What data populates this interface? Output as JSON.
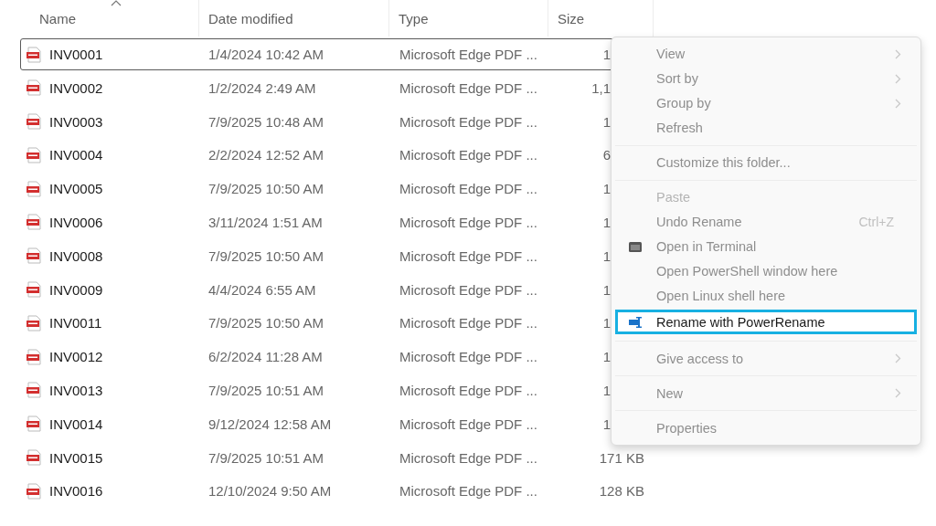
{
  "columns": [
    {
      "label": "Name",
      "sorted": true
    },
    {
      "label": "Date modified",
      "sorted": false
    },
    {
      "label": "Type",
      "sorted": false
    },
    {
      "label": "Size",
      "sorted": false
    }
  ],
  "rows": [
    {
      "name": "INV0001",
      "date": "1/4/2024 10:42 AM",
      "type": "Microsoft Edge PDF ...",
      "size": "1",
      "selected": true
    },
    {
      "name": "INV0002",
      "date": "1/2/2024 2:49 AM",
      "type": "Microsoft Edge PDF ...",
      "size": "1,1",
      "selected": false
    },
    {
      "name": "INV0003",
      "date": "7/9/2025 10:48 AM",
      "type": "Microsoft Edge PDF ...",
      "size": "1",
      "selected": false
    },
    {
      "name": "INV0004",
      "date": "2/2/2024 12:52 AM",
      "type": "Microsoft Edge PDF ...",
      "size": "6",
      "selected": false
    },
    {
      "name": "INV0005",
      "date": "7/9/2025 10:50 AM",
      "type": "Microsoft Edge PDF ...",
      "size": "1",
      "selected": false
    },
    {
      "name": "INV0006",
      "date": "3/11/2024 1:51 AM",
      "type": "Microsoft Edge PDF ...",
      "size": "1",
      "selected": false
    },
    {
      "name": "INV0008",
      "date": "7/9/2025 10:50 AM",
      "type": "Microsoft Edge PDF ...",
      "size": "1",
      "selected": false
    },
    {
      "name": "INV0009",
      "date": "4/4/2024 6:55 AM",
      "type": "Microsoft Edge PDF ...",
      "size": "1",
      "selected": false
    },
    {
      "name": "INV0011",
      "date": "7/9/2025 10:50 AM",
      "type": "Microsoft Edge PDF ...",
      "size": "1",
      "selected": false
    },
    {
      "name": "INV0012",
      "date": "6/2/2024 11:28 AM",
      "type": "Microsoft Edge PDF ...",
      "size": "1",
      "selected": false
    },
    {
      "name": "INV0013",
      "date": "7/9/2025 10:51 AM",
      "type": "Microsoft Edge PDF ...",
      "size": "1",
      "selected": false
    },
    {
      "name": "INV0014",
      "date": "9/12/2024 12:58 AM",
      "type": "Microsoft Edge PDF ...",
      "size": "1",
      "selected": false
    },
    {
      "name": "INV0015",
      "date": "7/9/2025 10:51 AM",
      "type": "Microsoft Edge PDF ...",
      "size": "171 KB",
      "selected": false
    },
    {
      "name": "INV0016",
      "date": "12/10/2024 9:50 AM",
      "type": "Microsoft Edge PDF ...",
      "size": "128 KB",
      "selected": false
    }
  ],
  "context_menu": [
    {
      "kind": "item",
      "label": "View",
      "submenu": true,
      "blurred": true,
      "selected": false
    },
    {
      "kind": "item",
      "label": "Sort by",
      "submenu": true,
      "blurred": true,
      "selected": false
    },
    {
      "kind": "item",
      "label": "Group by",
      "submenu": true,
      "blurred": true,
      "selected": false
    },
    {
      "kind": "item",
      "label": "Refresh",
      "submenu": false,
      "blurred": true,
      "selected": false
    },
    {
      "kind": "separator"
    },
    {
      "kind": "item",
      "label": "Customize this folder...",
      "submenu": false,
      "blurred": true,
      "selected": false
    },
    {
      "kind": "separator"
    },
    {
      "kind": "item",
      "label": "Paste",
      "submenu": false,
      "blurred": true,
      "disabled": true,
      "selected": false
    },
    {
      "kind": "item",
      "label": "Undo Rename",
      "shortcut": "Ctrl+Z",
      "submenu": false,
      "blurred": true,
      "selected": false
    },
    {
      "kind": "terminal",
      "label": "Open in Terminal",
      "submenu": false,
      "blurred": true,
      "selected": false
    },
    {
      "kind": "item",
      "label": "Open PowerShell window here",
      "submenu": false,
      "blurred": true,
      "selected": false
    },
    {
      "kind": "item",
      "label": "Open Linux shell here",
      "submenu": false,
      "blurred": true,
      "selected": false
    },
    {
      "kind": "rename",
      "label": "Rename with PowerRename",
      "submenu": false,
      "blurred": false,
      "selected": true
    },
    {
      "kind": "separator"
    },
    {
      "kind": "item",
      "label": "Give access to",
      "submenu": true,
      "blurred": true,
      "selected": false
    },
    {
      "kind": "separator"
    },
    {
      "kind": "item",
      "label": "New",
      "submenu": true,
      "blurred": true,
      "selected": false
    },
    {
      "kind": "separator"
    },
    {
      "kind": "item",
      "label": "Properties",
      "submenu": false,
      "blurred": true,
      "selected": false
    }
  ]
}
